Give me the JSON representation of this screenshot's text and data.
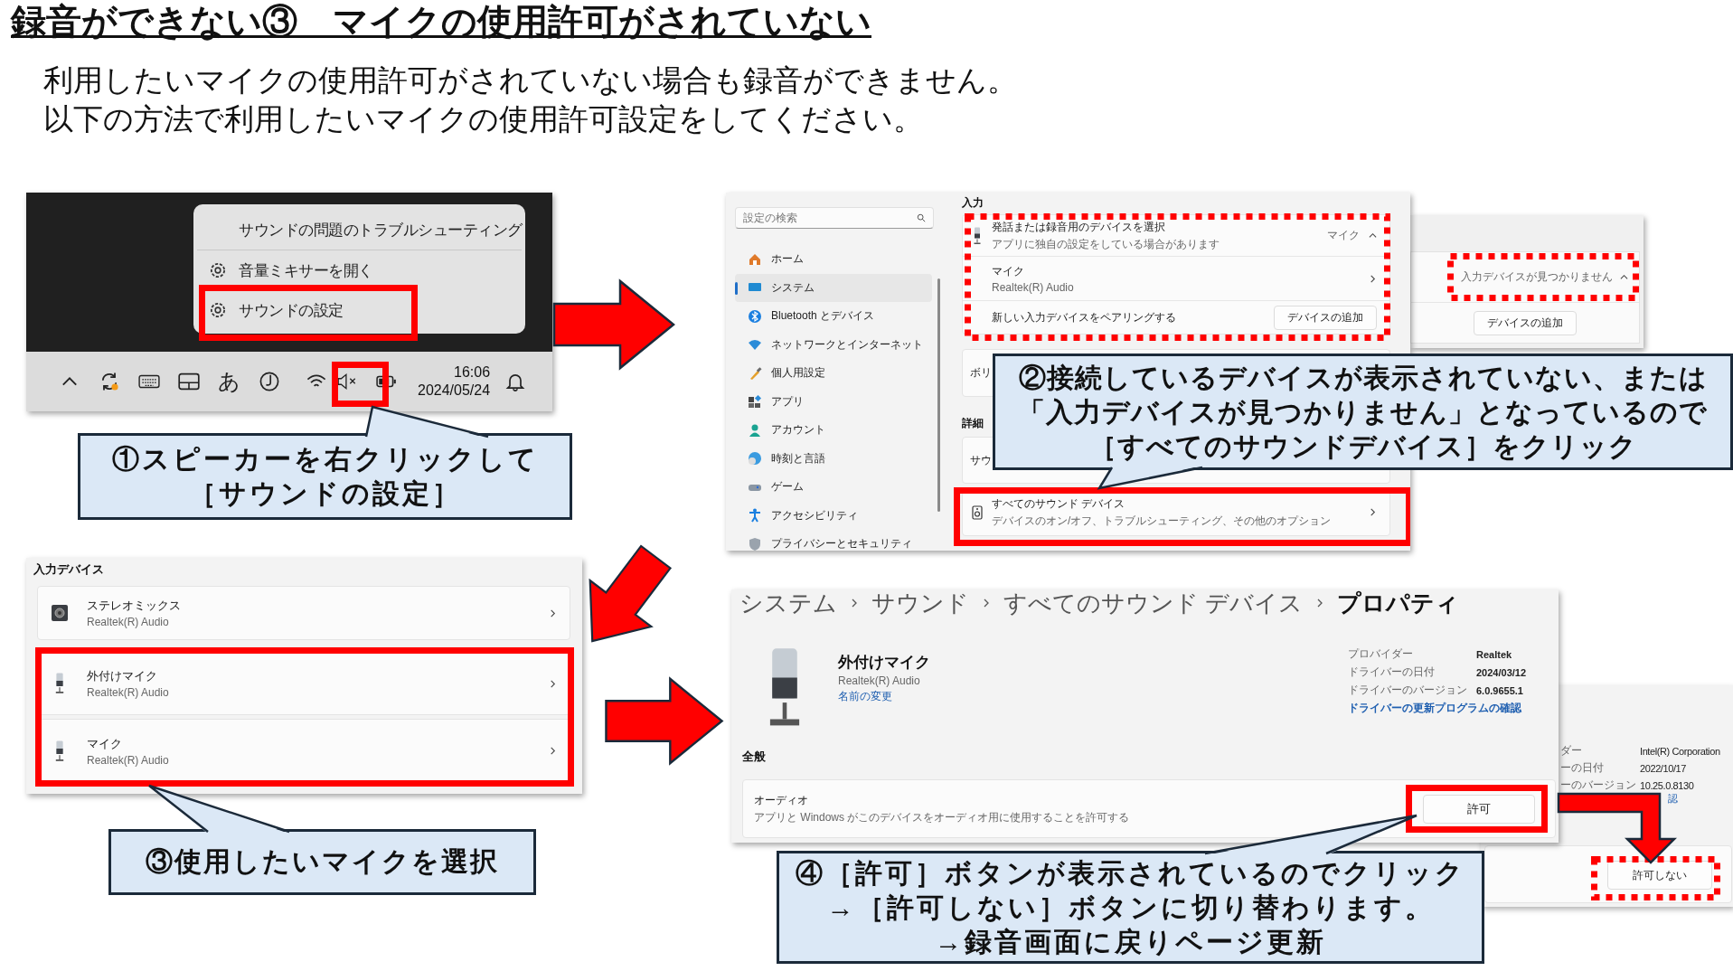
{
  "title": "録音ができない③　マイクの使用許可がされていない",
  "intro": [
    "利用したいマイクの使用許可がされていない場合も録音ができません。",
    "以下の方法で利用したいマイクの使用許可設定をしてください。"
  ],
  "taskbar_screenshot": {
    "menu": [
      {
        "label": "サウンドの問題のトラブルシューティング",
        "kind": "plain"
      },
      {
        "label": "音量ミキサーを開く",
        "kind": "gear"
      },
      {
        "label": "サウンドの設定",
        "kind": "gear"
      }
    ],
    "ime": "あ",
    "time": "16:06",
    "date": "2024/05/24"
  },
  "settings_screenshot": {
    "search": {
      "placeholder": "設定の検索"
    },
    "nav": [
      {
        "label": "ホーム",
        "selected": false
      },
      {
        "label": "システム",
        "selected": true
      },
      {
        "label": "Bluetooth とデバイス",
        "selected": false
      },
      {
        "label": "ネットワークとインターネット",
        "selected": false
      },
      {
        "label": "個人用設定",
        "selected": false
      },
      {
        "label": "アプリ",
        "selected": false
      },
      {
        "label": "アカウント",
        "selected": false
      },
      {
        "label": "時刻と言語",
        "selected": false
      },
      {
        "label": "ゲーム",
        "selected": false
      },
      {
        "label": "アクセシビリティ",
        "selected": false
      },
      {
        "label": "プライバシーとセキュリティ",
        "selected": false
      }
    ],
    "section": "入力",
    "rows": [
      {
        "kind": "expander",
        "title": "発話または録音用のデバイスを選択",
        "subtitle": "アプリに独自の設定をしている場合があります",
        "value": "マイク"
      },
      {
        "kind": "link",
        "title": "マイク",
        "subtitle": "Realtek(R) Audio"
      },
      {
        "kind": "button",
        "title": "新しい入力デバイスをペアリングする",
        "button": "デバイスの追加"
      }
    ],
    "partial_card": "ボリ",
    "section_2": "詳細",
    "partial_card_2": "サウ",
    "all_devices": {
      "title": "すべてのサウンド デバイス",
      "subtitle": "デバイスのオン/オフ、トラブルシューティング、その他のオプション"
    }
  },
  "settings_screenshot_2": {
    "status": "入力デバイスが見つかりません",
    "button": "デバイスの追加"
  },
  "input_devices_screenshot": {
    "heading": "入力デバイス",
    "devices": [
      {
        "name": "ステレオミックス",
        "driver": "Realtek(R) Audio",
        "kind": "speaker"
      },
      {
        "name": "外付けマイク",
        "driver": "Realtek(R) Audio",
        "kind": "mic"
      },
      {
        "name": "マイク",
        "driver": "Realtek(R) Audio",
        "kind": "mic"
      }
    ]
  },
  "properties_screenshot": {
    "breadcrumb": [
      "システム",
      "サウンド",
      "すべてのサウンド デバイス",
      "プロパティ"
    ],
    "device": {
      "name": "外付けマイク",
      "driver": "Realtek(R) Audio",
      "rename_link": "名前の変更"
    },
    "info": [
      {
        "label": "プロバイダー",
        "value": "Realtek"
      },
      {
        "label": "ドライバーの日付",
        "value": "2024/03/12"
      },
      {
        "label": "ドライバーのバージョン",
        "value": "6.0.9655.1"
      }
    ],
    "update_link": "ドライバーの更新プログラムの確認",
    "section": "全般",
    "audio": {
      "title": "オーディオ",
      "description": "アプリと Windows がこのデバイスをオーディオ用に使用することを許可する",
      "button": "許可"
    }
  },
  "properties_screenshot_2": {
    "info": [
      {
        "label": "ダー",
        "value": "Intel(R) Corporation"
      },
      {
        "label": "ーの日付",
        "value": "2022/10/17"
      },
      {
        "label": "ーのバージョン",
        "value": "10.25.0.8130"
      }
    ],
    "link": "認",
    "button": "許可しない"
  },
  "callouts": [
    {
      "lines": [
        "①スピーカーを右クリックして",
        "［サウンドの設定］"
      ]
    },
    {
      "lines": [
        "②接続しているデバイスが表示されていない、または",
        "「入力デバイスが見つかりません」となっているので",
        "［すべてのサウンドデバイス］をクリック"
      ]
    },
    {
      "lines": [
        "③使用したいマイクを選択"
      ]
    },
    {
      "lines": [
        "④［許可］ボタンが表示されているのでクリック",
        "→［許可しない］ボタンに切り替わります。",
        "→録音画面に戻りページ更新"
      ]
    }
  ]
}
